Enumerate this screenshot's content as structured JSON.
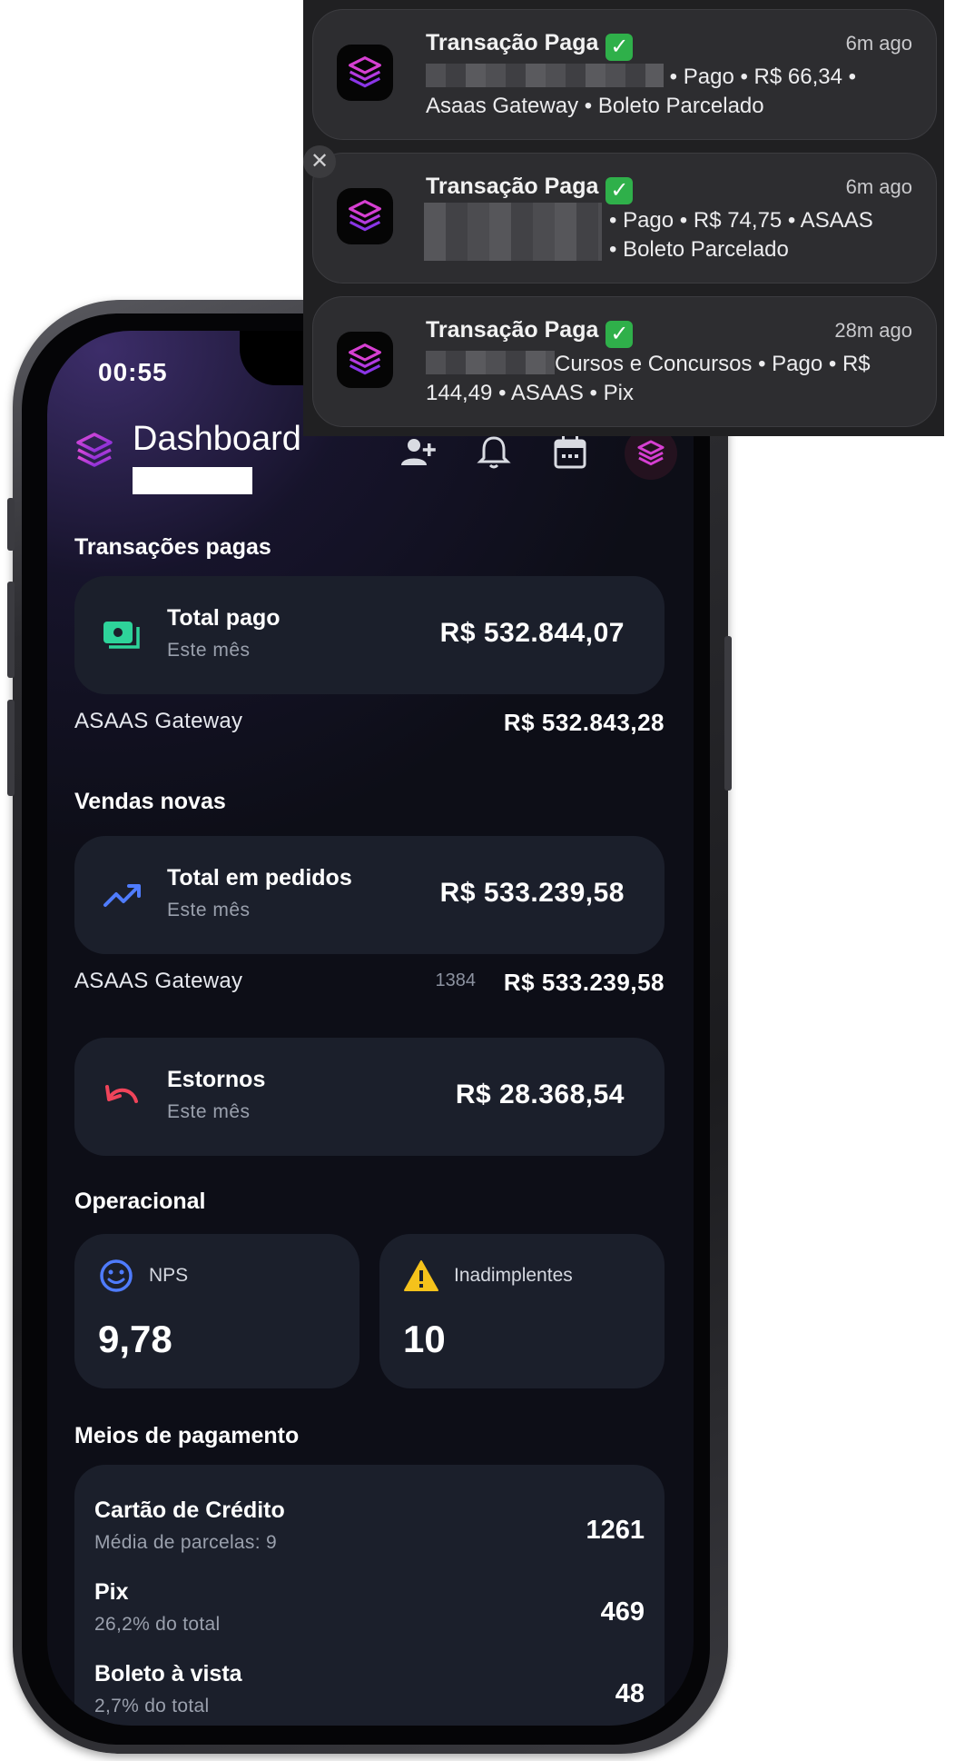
{
  "status_bar": {
    "time": "00:55"
  },
  "header": {
    "title": "Dashboard",
    "icons": [
      "add-user-icon",
      "bell-icon",
      "calendar-icon",
      "avatar"
    ]
  },
  "sections": {
    "paid": {
      "title": "Transações pagas",
      "card": {
        "label": "Total pago",
        "sub": "Este mês",
        "value": "R$ 532.844,07",
        "icon": "cash-icon"
      },
      "gateway": {
        "label": "ASAAS Gateway",
        "value": "R$ 532.843,28"
      }
    },
    "new_sales": {
      "title": "Vendas novas",
      "card": {
        "label": "Total em pedidos",
        "sub": "Este mês",
        "value": "R$ 533.239,58",
        "icon": "trend-up-icon"
      },
      "gateway": {
        "label": "ASAAS Gateway",
        "count": "1384",
        "value": "R$ 533.239,58"
      }
    },
    "refunds": {
      "card": {
        "label": "Estornos",
        "sub": "Este mês",
        "value": "R$ 28.368,54",
        "icon": "undo-icon"
      }
    },
    "operational": {
      "title": "Operacional",
      "nps": {
        "label": "NPS",
        "value": "9,78",
        "icon": "smile-icon"
      },
      "defaulters": {
        "label": "Inadimplentes",
        "value": "10",
        "icon": "warning-icon"
      }
    },
    "payment_methods": {
      "title": "Meios de pagamento",
      "items": [
        {
          "name": "Cartão de Crédito",
          "detail": "Média de parcelas: 9",
          "value": "1261"
        },
        {
          "name": "Pix",
          "detail": "26,2% do total",
          "value": "469"
        },
        {
          "name": "Boleto à vista",
          "detail": "2,7% do total",
          "value": "48"
        }
      ]
    }
  },
  "notifications": [
    {
      "title": "Transação Paga",
      "time": "6m ago",
      "line1": "• Pago • R$ 66,34 •",
      "line2": "Asaas Gateway • Boleto Parcelado"
    },
    {
      "title": "Transação Paga",
      "time": "6m ago",
      "line1": "• Pago • R$ 74,75 • ASAAS",
      "line2": "• Boleto Parcelado"
    },
    {
      "title": "Transação Paga",
      "time": "28m ago",
      "line1": "Cursos e Concursos • Pago • R$",
      "line2": "144,49 • ASAAS • Pix"
    }
  ],
  "colors": {
    "background": "#0d0e17",
    "card": "#1b1f2b",
    "accent_green": "#2ed39a",
    "accent_blue": "#4f7cff",
    "accent_red": "#f0445a",
    "accent_yellow": "#f5c21b",
    "logo_magenta": "#d63fd2"
  }
}
